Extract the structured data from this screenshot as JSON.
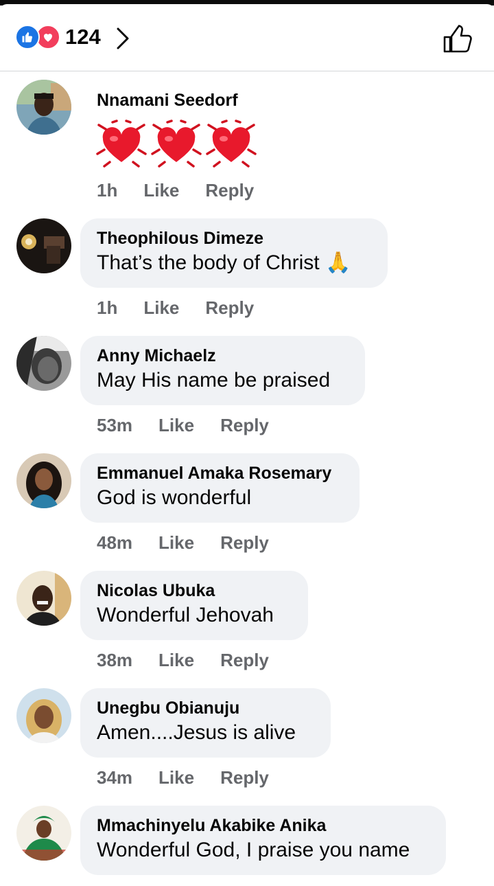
{
  "header": {
    "reaction_count": "124",
    "reaction_icons": [
      "like-icon",
      "love-icon"
    ],
    "colors": {
      "like": "#1b74e4",
      "love": "#f23e5c"
    }
  },
  "comments": [
    {
      "name": "Nnamani Seedorf",
      "text": "",
      "emoji": "heart-icon heart-icon heart-icon",
      "time": "1h",
      "like": "Like",
      "reply": "Reply"
    },
    {
      "name": "Theophilous Dimeze",
      "text": "That’s the body of Christ 🙏",
      "time": "1h",
      "like": "Like",
      "reply": "Reply"
    },
    {
      "name": "Anny Michaelz",
      "text": "May His name be praised",
      "time": "53m",
      "like": "Like",
      "reply": "Reply"
    },
    {
      "name": "Emmanuel Amaka Rosemary",
      "text": "God is wonderful",
      "time": "48m",
      "like": "Like",
      "reply": "Reply"
    },
    {
      "name": "Nicolas Ubuka",
      "text": "Wonderful Jehovah",
      "time": "38m",
      "like": "Like",
      "reply": "Reply"
    },
    {
      "name": "Unegbu Obianuju",
      "text": "Amen....Jesus is alive",
      "time": "34m",
      "like": "Like",
      "reply": "Reply"
    },
    {
      "name": "Mmachinyelu Akabike Anika",
      "text": "Wonderful God, I praise you name",
      "time": "",
      "like": "",
      "reply": ""
    }
  ]
}
